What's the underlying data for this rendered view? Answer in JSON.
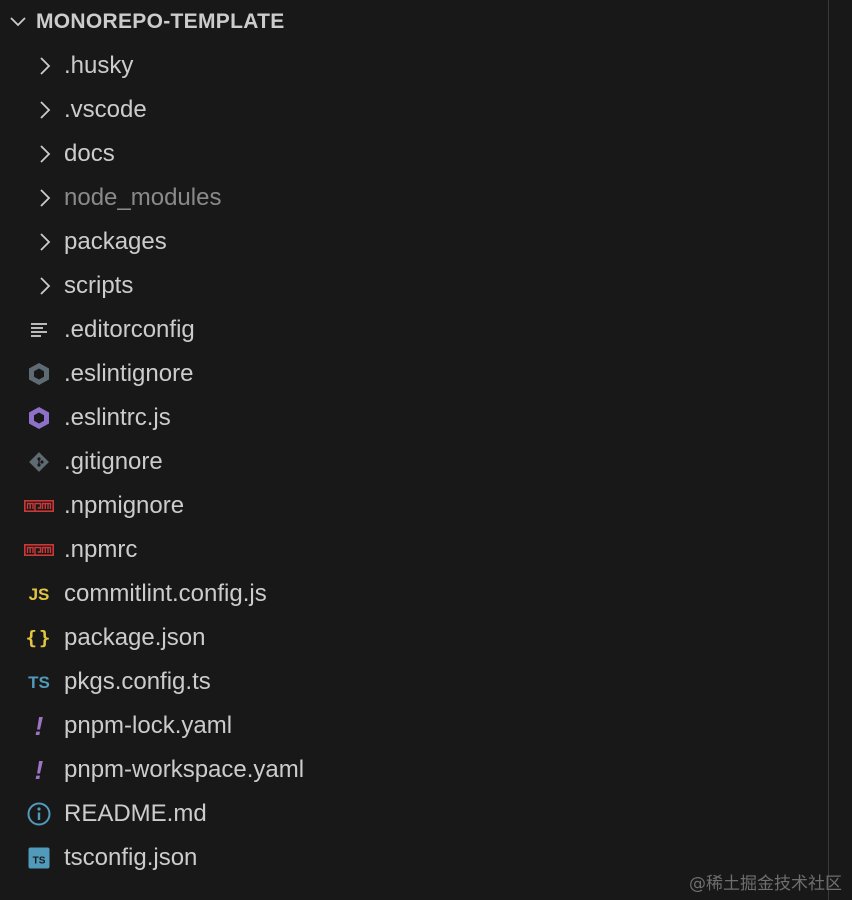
{
  "explorer": {
    "project_title": "MONOREPO-TEMPLATE",
    "items": [
      {
        "label": ".husky",
        "icon": "chevron-right-icon",
        "kind": "folder",
        "dimmed": false
      },
      {
        "label": ".vscode",
        "icon": "chevron-right-icon",
        "kind": "folder",
        "dimmed": false
      },
      {
        "label": "docs",
        "icon": "chevron-right-icon",
        "kind": "folder",
        "dimmed": false
      },
      {
        "label": "node_modules",
        "icon": "chevron-right-icon",
        "kind": "folder",
        "dimmed": true
      },
      {
        "label": "packages",
        "icon": "chevron-right-icon",
        "kind": "folder",
        "dimmed": false
      },
      {
        "label": "scripts",
        "icon": "chevron-right-icon",
        "kind": "folder",
        "dimmed": false
      },
      {
        "label": ".editorconfig",
        "icon": "lines-icon",
        "kind": "file",
        "dimmed": false
      },
      {
        "label": ".eslintignore",
        "icon": "eslint-gray-icon",
        "kind": "file",
        "dimmed": false
      },
      {
        "label": ".eslintrc.js",
        "icon": "eslint-purple-icon",
        "kind": "file",
        "dimmed": false
      },
      {
        "label": ".gitignore",
        "icon": "git-icon",
        "kind": "file",
        "dimmed": false
      },
      {
        "label": ".npmignore",
        "icon": "npm-icon",
        "kind": "file",
        "dimmed": false
      },
      {
        "label": ".npmrc",
        "icon": "npm-icon",
        "kind": "file",
        "dimmed": false
      },
      {
        "label": "commitlint.config.js",
        "icon": "js-icon",
        "icon_text": "JS",
        "kind": "file",
        "dimmed": false
      },
      {
        "label": "package.json",
        "icon": "json-icon",
        "icon_text": "{}",
        "kind": "file",
        "dimmed": false
      },
      {
        "label": "pkgs.config.ts",
        "icon": "ts-icon",
        "icon_text": "TS",
        "kind": "file",
        "dimmed": false
      },
      {
        "label": "pnpm-lock.yaml",
        "icon": "yaml-icon",
        "icon_text": "!",
        "kind": "file",
        "dimmed": false
      },
      {
        "label": "pnpm-workspace.yaml",
        "icon": "yaml-icon",
        "icon_text": "!",
        "kind": "file",
        "dimmed": false
      },
      {
        "label": "README.md",
        "icon": "info-icon",
        "kind": "file",
        "dimmed": false
      },
      {
        "label": "tsconfig.json",
        "icon": "tsconfig-icon",
        "icon_text": "TS",
        "kind": "file",
        "dimmed": false
      }
    ]
  },
  "watermark": "@稀土掘金技术社区",
  "colors": {
    "background": "#181818",
    "text": "#cccccc",
    "dim_text": "#8a8a8a",
    "eslint_purple": "#8e70c8",
    "npm_red": "#cb3837",
    "js_yellow": "#e2c541",
    "ts_blue": "#519aba",
    "yaml_purple": "#a074c4"
  }
}
